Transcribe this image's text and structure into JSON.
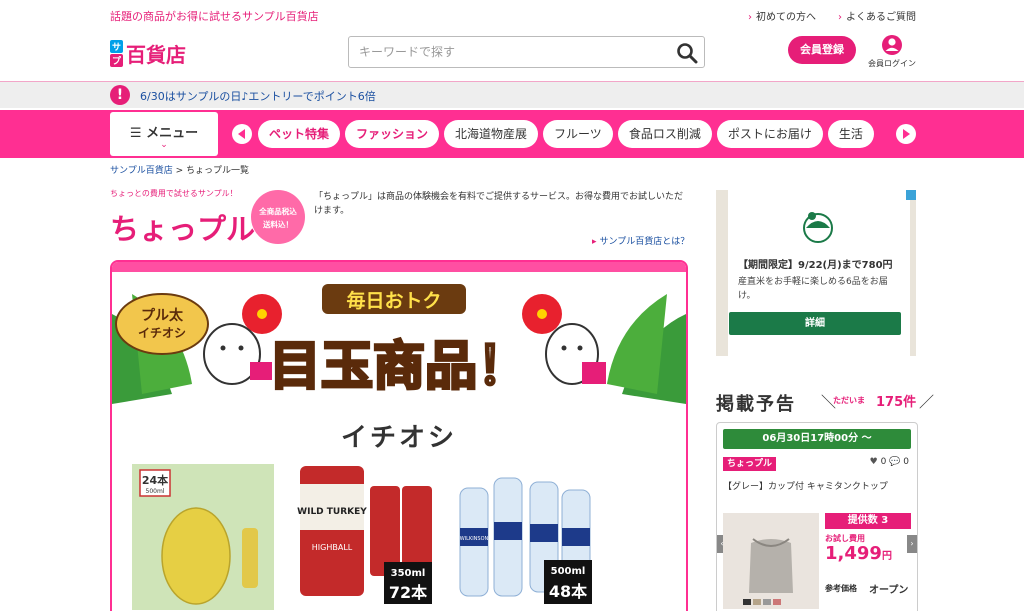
{
  "header": {
    "tagline": "話題の商品がお得に試せるサンプル百貨店",
    "links": [
      "初めての方へ",
      "よくあるご質問"
    ],
    "logo_text": "サンプル百貨店",
    "search_placeholder": "キーワードで探す",
    "register_label": "会員登録",
    "login_label": "会員ログイン"
  },
  "notice": {
    "icon": "!",
    "text": "6/30はサンプルの日♪エントリーでポイント6倍"
  },
  "nav": {
    "menu_label": "メニュー",
    "categories": [
      {
        "label": "ペット特集",
        "hot": true
      },
      {
        "label": "ファッション",
        "hot": true
      },
      {
        "label": "北海道物産展",
        "hot": false
      },
      {
        "label": "フルーツ",
        "hot": false
      },
      {
        "label": "食品ロス削減",
        "hot": false
      },
      {
        "label": "ポストにお届け",
        "hot": false
      },
      {
        "label": "生活",
        "hot": false
      }
    ]
  },
  "breadcrumb": {
    "home": "サンプル百貨店",
    "sep": ">",
    "current": "ちょっプル一覧"
  },
  "chopul": {
    "catch": "ちょっとの費用で試せるサンプル！",
    "logo": "ちょっプル",
    "badge_line1": "全商品税込",
    "badge_line2": "送料込！",
    "description": "「ちょっプル」は商品の体験機会を有料でご提供するサービス。お得な費用でお試しいただけます。",
    "about_link": "サンプル百貨店とは？"
  },
  "promo": {
    "ribbon_line1": "プル太",
    "ribbon_line2": "イチオシ",
    "banner_sub": "毎日おトク",
    "banner_main": "目玉商品！",
    "pickup_title": "イチオシ",
    "products": [
      {
        "badge_count": "24本",
        "badge_size": "500ml"
      },
      {
        "brand": "WILD TURKEY",
        "subname": "HIGHBALL",
        "volume": "350ml",
        "count": "72本"
      },
      {
        "brand": "WILKINSON",
        "volume": "500ml",
        "count": "48本"
      }
    ]
  },
  "ad": {
    "title": "【期間限定】9/22(月)まで780円",
    "subtitle": "産直米をお手軽に楽しめる6品をお届け。",
    "button": "詳細"
  },
  "preview": {
    "heading": "掲載予告",
    "now_label": "ただいま",
    "count": "175件",
    "card": {
      "date": "06月30日17時00分 〜",
      "tag": "ちょっプル",
      "likes": "0",
      "comments": "0",
      "name": "【グレー】カップ付 キャミタンクトップ",
      "stock": "提供数 3",
      "price_label": "お試し費用",
      "price": "1,499",
      "price_unit": "円",
      "ref_label": "参考価格",
      "ref_value": "オープン"
    }
  },
  "colors": {
    "brand_pink": "#e61e78",
    "nav_pink": "#ff2f92",
    "green": "#2e8b3a",
    "link_blue": "#1a4fa0"
  }
}
